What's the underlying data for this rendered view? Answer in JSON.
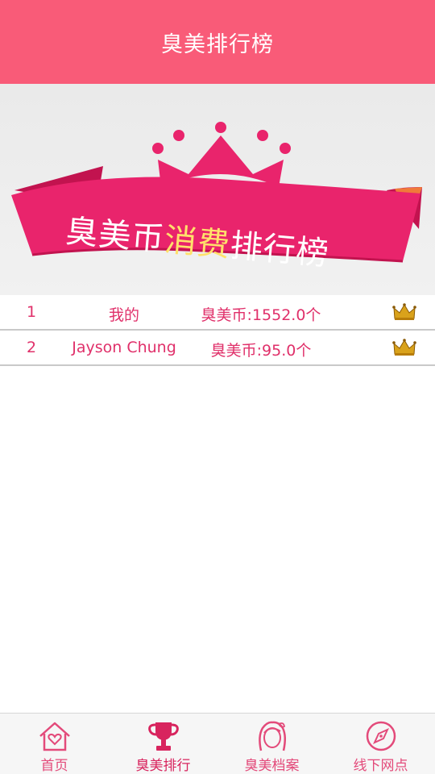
{
  "header": {
    "title": "臭美排行榜"
  },
  "banner": {
    "text_prefix": "臭美币",
    "text_highlight": "消费",
    "text_suffix": "排行榜",
    "ribbon_color": "#e9246c",
    "highlight_color": "#ffe16b",
    "icon": "crown-icon"
  },
  "rankings": [
    {
      "rank": "1",
      "name": "我的",
      "coins": "臭美币:1552.0个",
      "icon": "crown-icon"
    },
    {
      "rank": "2",
      "name": "Jayson Chung",
      "coins": "臭美币:95.0个",
      "icon": "crown-icon"
    }
  ],
  "nav": {
    "items": [
      {
        "label": "首页",
        "icon": "home-heart-icon",
        "active": false
      },
      {
        "label": "臭美排行",
        "icon": "trophy-icon",
        "active": true
      },
      {
        "label": "臭美档案",
        "icon": "girl-face-icon",
        "active": false
      },
      {
        "label": "线下网点",
        "icon": "compass-icon",
        "active": false
      }
    ]
  },
  "colors": {
    "brand": "#f95b78",
    "accent_text": "#e0306a"
  }
}
